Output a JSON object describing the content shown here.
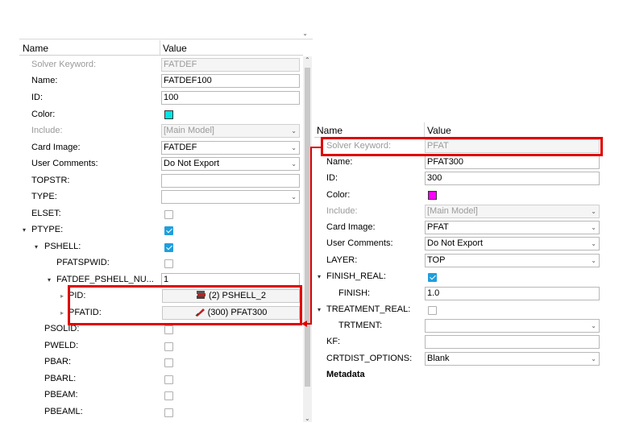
{
  "left": {
    "header": {
      "name": "Name",
      "value": "Value"
    },
    "rows": [
      {
        "label": "Solver Keyword:",
        "value": "FATDEF"
      },
      {
        "label": "Name:",
        "value": "FATDEF100"
      },
      {
        "label": "ID:",
        "value": "100"
      },
      {
        "label": "Color:",
        "swatch": "#00e5e5"
      },
      {
        "label": "Include:",
        "value": "[Main Model]"
      },
      {
        "label": "Card Image:",
        "value": "FATDEF"
      },
      {
        "label": "User Comments:",
        "value": "Do Not Export"
      },
      {
        "label": "TOPSTR:",
        "value": ""
      },
      {
        "label": "TYPE:",
        "value": ""
      },
      {
        "label": "ELSET:"
      },
      {
        "label": "PTYPE:"
      },
      {
        "label": "PSHELL:"
      },
      {
        "label": "PFATSPWID:"
      },
      {
        "label": "FATDEF_PSHELL_NU...",
        "value": "1"
      },
      {
        "label": "PID:",
        "value": "(2) PSHELL_2",
        "icon": "pshell-entity-icon"
      },
      {
        "label": "PFATID:",
        "value": "(300) PFAT300",
        "icon": "pfat-entity-icon"
      },
      {
        "label": "PSOLID:"
      },
      {
        "label": "PWELD:"
      },
      {
        "label": "PBAR:"
      },
      {
        "label": "PBARL:"
      },
      {
        "label": "PBEAM:"
      },
      {
        "label": "PBEAML:"
      }
    ]
  },
  "right": {
    "header": {
      "name": "Name",
      "value": "Value"
    },
    "rows": [
      {
        "label": "Solver Keyword:",
        "value": "PFAT"
      },
      {
        "label": "Name:",
        "value": "PFAT300"
      },
      {
        "label": "ID:",
        "value": "300"
      },
      {
        "label": "Color:",
        "swatch": "#ff00ff"
      },
      {
        "label": "Include:",
        "value": "[Main Model]"
      },
      {
        "label": "Card Image:",
        "value": "PFAT"
      },
      {
        "label": "User Comments:",
        "value": "Do Not Export"
      },
      {
        "label": "LAYER:",
        "value": "TOP"
      },
      {
        "label": "FINISH_REAL:"
      },
      {
        "label": "FINISH:",
        "value": "1.0"
      },
      {
        "label": "TREATMENT_REAL:"
      },
      {
        "label": "TRTMENT:",
        "value": ""
      },
      {
        "label": "KF:",
        "value": ""
      },
      {
        "label": "CRTDIST_OPTIONS:",
        "value": "Blank"
      },
      {
        "label": "Metadata"
      }
    ]
  },
  "colors": {
    "highlight": "#e00000",
    "checkbox_on": "#1f9fde"
  }
}
